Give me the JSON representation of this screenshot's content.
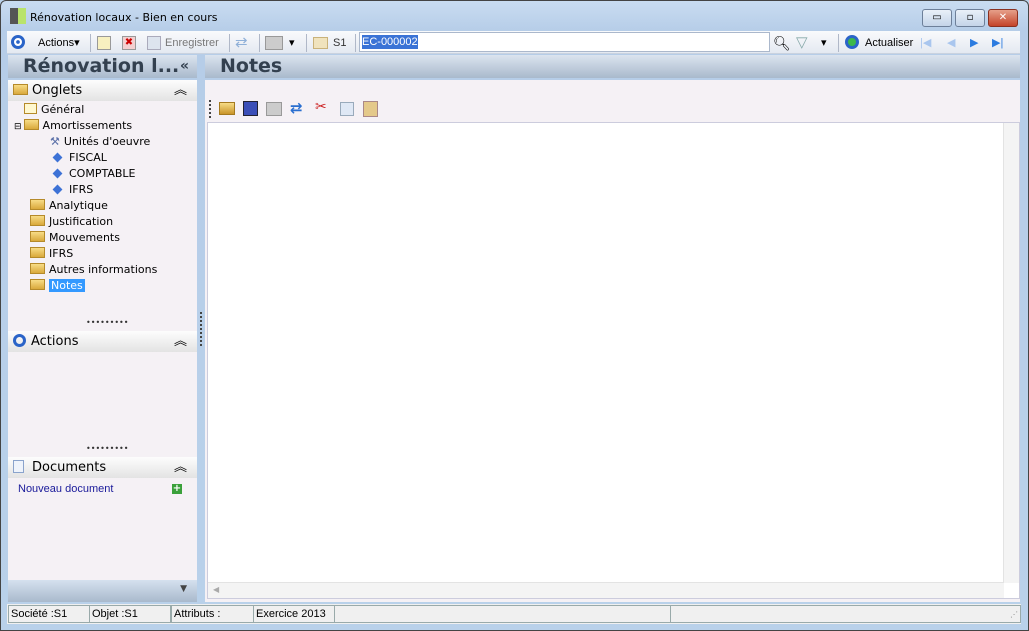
{
  "window": {
    "title": "Rénovation locaux -  Bien en cours",
    "min": "▭",
    "max": "▫",
    "close": "✕"
  },
  "toolbar": {
    "actions": "Actions",
    "save": "Enregistrer",
    "folder": "S1",
    "record_id": "EC-000002",
    "refresh": "Actualiser"
  },
  "left_header": "Rénovation l...",
  "collapse": "«",
  "main_header": "Notes",
  "onglets": {
    "title": "Onglets",
    "items": [
      "Général",
      "Amortissements",
      "Unités d'oeuvre",
      "FISCAL",
      "COMPTABLE",
      "IFRS",
      "Analytique",
      "Justification",
      "Mouvements",
      "IFRS",
      "Autres informations",
      "Notes"
    ]
  },
  "actions_panel": {
    "title": "Actions"
  },
  "documents": {
    "title": "Documents",
    "new": "Nouveau document"
  },
  "status": {
    "societe": "Société :S1",
    "objet": "Objet :S1",
    "attributs": "Attributs :",
    "exercice": "Exercice 2013"
  }
}
